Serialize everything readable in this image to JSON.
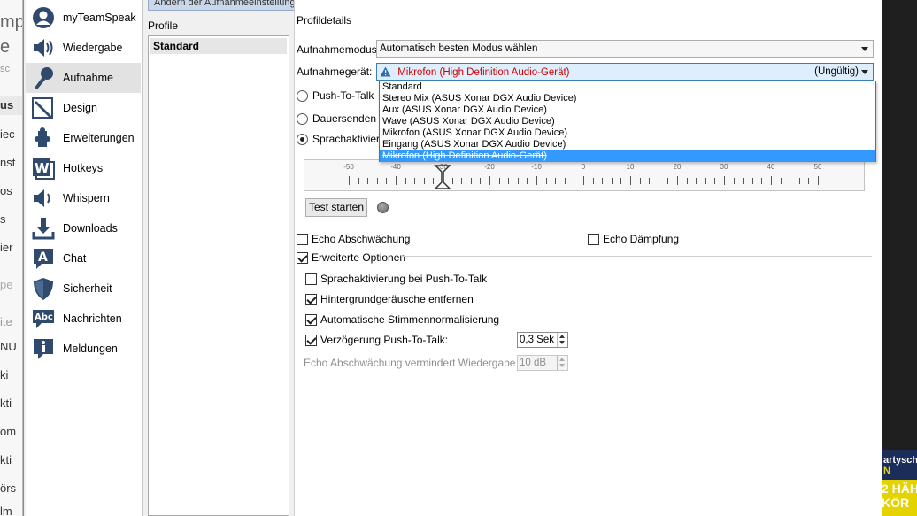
{
  "background_left": {
    "fragments": [
      "mp",
      "e",
      "sc",
      "us",
      "iec",
      "nst",
      "os",
      "s",
      "ier",
      "pe",
      "ite",
      "NU",
      "ki",
      "kti",
      "om",
      "kti",
      "örs",
      "lm"
    ]
  },
  "background_right": {
    "ad_top": "artysch",
    "ad_top2": "N",
    "ad_bottom1": "2 HÄH",
    "ad_bottom2": "KÖR"
  },
  "dialog": {
    "title": "Ändern der Aufnahmeeinstellungen"
  },
  "sidebar": {
    "items": [
      {
        "label": "myTeamSpeak",
        "icon": "user-icon",
        "active": false
      },
      {
        "label": "Wiedergabe",
        "icon": "speaker-icon",
        "active": false
      },
      {
        "label": "Aufnahme",
        "icon": "microphone-icon",
        "active": true
      },
      {
        "label": "Design",
        "icon": "design-pen-icon",
        "active": false
      },
      {
        "label": "Erweiterungen",
        "icon": "puzzle-icon",
        "active": false
      },
      {
        "label": "Hotkeys",
        "icon": "keyboard-w-icon",
        "active": false
      },
      {
        "label": "Whispern",
        "icon": "whisper-speaker-icon",
        "active": false
      },
      {
        "label": "Downloads",
        "icon": "download-icon",
        "active": false
      },
      {
        "label": "Chat",
        "icon": "chat-a-icon",
        "active": false
      },
      {
        "label": "Sicherheit",
        "icon": "shield-icon",
        "active": false
      },
      {
        "label": "Nachrichten",
        "icon": "abc-bubble-icon",
        "active": false
      },
      {
        "label": "Meldungen",
        "icon": "info-icon",
        "active": false
      }
    ]
  },
  "profiles": {
    "title": "Profile",
    "items": [
      "Standard"
    ]
  },
  "details": {
    "title": "Profildetails",
    "mode_label": "Aufnahmemodus:",
    "mode_value": "Automatisch besten Modus wählen",
    "device_label": "Aufnahmegerät:",
    "device_value": "Mikrofon (High Definition Audio-Gerät)",
    "device_status": "(Ungültig)",
    "device_options": [
      "Standard",
      "Stereo Mix (ASUS Xonar DGX Audio Device)",
      "Aux (ASUS Xonar DGX Audio Device)",
      "Wave (ASUS Xonar DGX Audio Device)",
      "Mikrofon (ASUS Xonar DGX Audio Device)",
      "Eingang (ASUS Xonar DGX Audio Device)",
      "Mikrofon (High Definition Audio-Gerät)"
    ],
    "radio_ptt": "Push-To-Talk",
    "radio_continuous": "Dauersenden",
    "radio_voice": "Sprachaktivierung",
    "slider_labels": [
      "-50",
      "-40",
      "-30",
      "-20",
      "-10",
      "0",
      "10",
      "20",
      "30",
      "40",
      "50"
    ],
    "slider_value": -30,
    "test_button": "Test starten",
    "echo_reduction": "Echo Abschwächung",
    "echo_cancellation": "Echo Dämpfung",
    "advanced": "Erweiterte Optionen",
    "opt_voice_ptt": "Sprachaktivierung bei Push-To-Talk",
    "opt_noise": "Hintergrundgeräusche entfernen",
    "opt_normalize": "Automatische Stimmennormalisierung",
    "opt_delay": "Verzögerung Push-To-Talk:",
    "delay_value": "0,3 Sek",
    "echo_reduce_label": "Echo Abschwächung vermindert Wiedergabe um:",
    "echo_reduce_value": "10 dB"
  }
}
